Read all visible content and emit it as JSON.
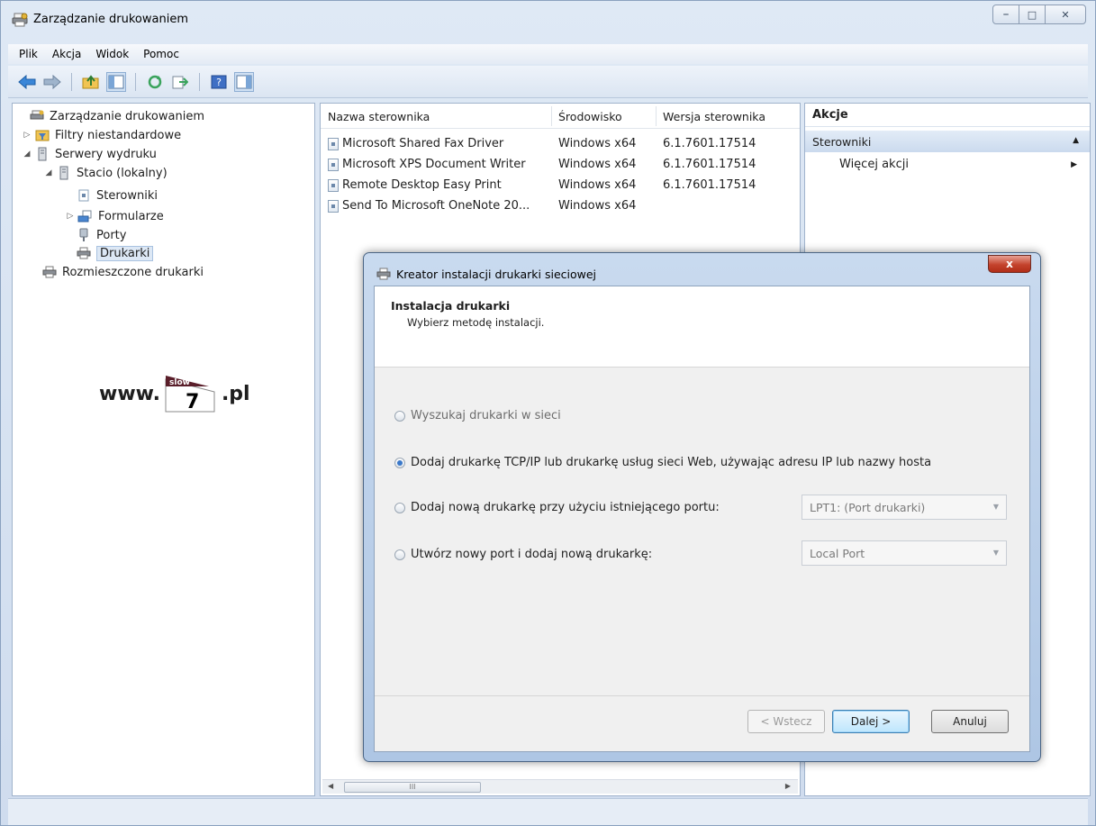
{
  "window": {
    "title": "Zarządzanie drukowaniem"
  },
  "menu": [
    "Plik",
    "Akcja",
    "Widok",
    "Pomoc"
  ],
  "tree": {
    "root": "Zarządzanie drukowaniem",
    "filters": "Filtry niestandardowe",
    "servers": "Serwery wydruku",
    "local": "Stacio (lokalny)",
    "drivers": "Sterowniki",
    "forms": "Formularze",
    "ports": "Porty",
    "printers": "Drukarki",
    "deployed": "Rozmieszczone drukarki"
  },
  "watermark": {
    "prefix": "www.",
    "top": "slow",
    "bottom": "7",
    "suffix": ".pl"
  },
  "drivers_list": {
    "columns": [
      "Nazwa sterownika",
      "Środowisko",
      "Wersja sterownika"
    ],
    "rows": [
      [
        "Microsoft Shared Fax Driver",
        "Windows x64",
        "6.1.7601.17514"
      ],
      [
        "Microsoft XPS Document Writer",
        "Windows x64",
        "6.1.7601.17514"
      ],
      [
        "Remote Desktop Easy Print",
        "Windows x64",
        "6.1.7601.17514"
      ],
      [
        "Send To Microsoft OneNote 20...",
        "Windows x64",
        ""
      ]
    ],
    "scroll_thumb": "III"
  },
  "actions": {
    "header": "Akcje",
    "section": "Sterowniki",
    "more": "Więcej akcji"
  },
  "dialog": {
    "title": "Kreator instalacji drukarki sieciowej",
    "close": "x",
    "heading": "Instalacja drukarki",
    "subheading": "Wybierz metodę instalacji.",
    "options": [
      "Wyszukaj drukarki w sieci",
      "Dodaj drukarkę TCP/IP lub drukarkę usług sieci Web, używając adresu IP lub nazwy hosta",
      "Dodaj nową drukarkę przy użyciu istniejącego portu:",
      "Utwórz nowy port i dodaj nową drukarkę:"
    ],
    "selected_option": 1,
    "existing_port": "LPT1: (Port drukarki)",
    "new_port_type": "Local Port",
    "buttons": {
      "back": "< Wstecz",
      "next": "Dalej >",
      "cancel": "Anuluj"
    }
  }
}
